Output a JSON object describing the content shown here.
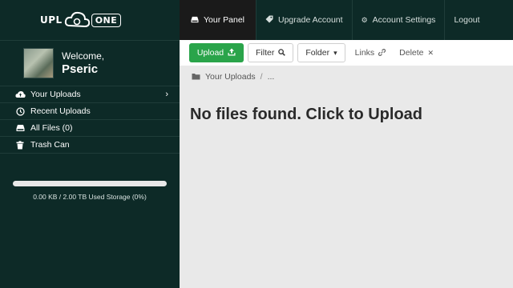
{
  "brand": {
    "logo_text_1": "UPL",
    "logo_text_2": "ONE"
  },
  "user": {
    "welcome": "Welcome,",
    "name": "Pseric"
  },
  "sidebar": {
    "items": [
      {
        "label": "Your Uploads",
        "icon": "cloud-upload-icon"
      },
      {
        "label": "Recent Uploads",
        "icon": "clock-icon"
      },
      {
        "label": "All Files (0)",
        "icon": "drive-icon"
      },
      {
        "label": "Trash Can",
        "icon": "trash-icon"
      }
    ],
    "storage_text": "0.00 KB / 2.00 TB Used Storage (0%)",
    "storage_percent": 0
  },
  "topnav": {
    "tabs": [
      {
        "label": "Your Panel",
        "icon": "drive-icon",
        "active": true
      },
      {
        "label": "Upgrade Account",
        "icon": "tag-icon"
      },
      {
        "label": "Account Settings",
        "icon": "gear-icon"
      },
      {
        "label": "Logout"
      }
    ]
  },
  "toolbar": {
    "upload": "Upload",
    "filter": "Filter",
    "folder": "Folder",
    "links": "Links",
    "delete": "Delete"
  },
  "breadcrumb": {
    "root": "Your Uploads",
    "sep": "/",
    "more": "..."
  },
  "main": {
    "empty_message": "No files found. Click to Upload"
  },
  "colors": {
    "sidebar_bg": "#0d2a27",
    "upload_green": "#2aa44a",
    "active_tab": "#1a1a1a"
  }
}
